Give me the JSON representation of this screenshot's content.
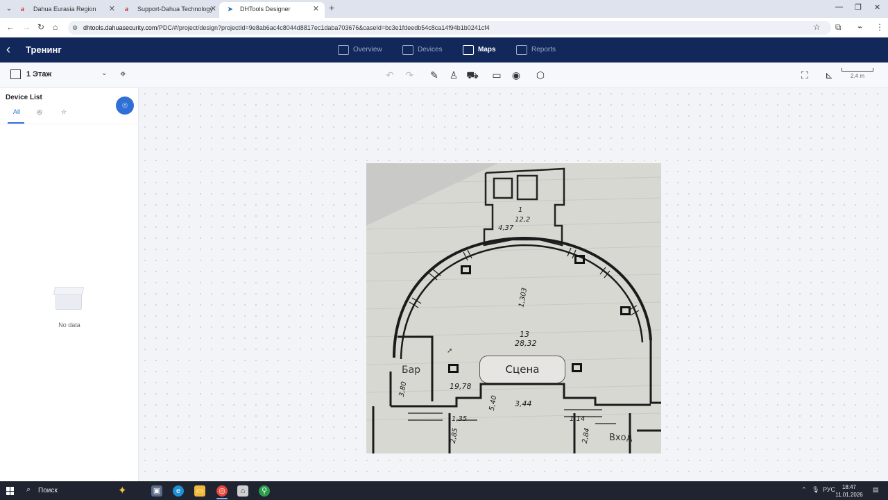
{
  "browser": {
    "tabs": [
      {
        "title": "Dahua Eurasia Region",
        "active": false
      },
      {
        "title": "Support-Dahua Technology",
        "active": false
      },
      {
        "title": "DHTools Designer",
        "active": true
      }
    ],
    "url_host": "dhtools.dahuasecurity.com",
    "url_rest": "/PDC/#/project/design?projectId=9e8ab6ac4c8044d8817ec1daba703676&caseId=bc3e1fdeedb54c8ca14f94b1b0241cf4"
  },
  "header": {
    "project_title": "Тренинг",
    "nav": [
      {
        "label": "Overview",
        "active": false
      },
      {
        "label": "Devices",
        "active": false
      },
      {
        "label": "Maps",
        "active": true
      },
      {
        "label": "Reports",
        "active": false
      }
    ]
  },
  "toolbar": {
    "floor": "1 Этаж",
    "scale": "2.4 m"
  },
  "sidebar": {
    "title": "Device List",
    "tabs": [
      {
        "label": "All",
        "active": true,
        "icon": "camera-icon"
      },
      {
        "label": "",
        "active": false,
        "icon": "camera-icon"
      },
      {
        "label": "",
        "active": false,
        "icon": "star-icon"
      }
    ],
    "empty_text": "No data"
  },
  "floorplan": {
    "stage_label": "Сцена",
    "bar_label": "Бар",
    "entrance_label": "Вход",
    "handwritten": {
      "t1": "1",
      "t2": "12,2",
      "t3": "4,37",
      "t4": "1,303",
      "t5": "13",
      "t6": "28,32",
      "t7": "19,78",
      "t8": "3,80",
      "t9": "5,40",
      "t10": "3,44",
      "t11": "1,35",
      "t12": "1,14",
      "t13": "2,85",
      "t14": "2,84"
    }
  },
  "taskbar": {
    "search_label": "Поиск",
    "lang": "РУС",
    "time": "18:47",
    "date": "11.01.2026"
  },
  "colors": {
    "header_bg": "#13285a",
    "accent": "#2f6fd6"
  }
}
